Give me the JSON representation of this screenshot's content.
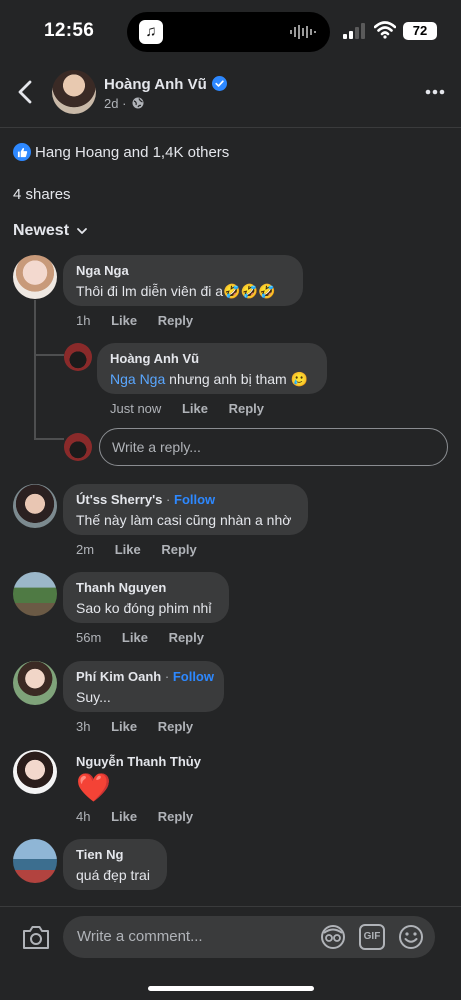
{
  "status_bar": {
    "time": "12:56",
    "battery": "72",
    "music_glyph": "♫"
  },
  "post": {
    "author_name": "Hoàng Anh Vũ",
    "time": "2d",
    "time_separator": "·",
    "reactions_text": "Hang Hoang and 1,4K others",
    "shares_text": "4 shares",
    "sort_label": "Newest"
  },
  "comments": [
    {
      "name": "Nga Nga",
      "text": "Thôi đi lm diễn viên đi a🤣🤣🤣",
      "time": "1h",
      "like": "Like",
      "reply": "Reply"
    },
    {
      "name": "Hoàng Anh Vũ",
      "mention": "Nga Nga",
      "text": " nhưng anh bị tham 🥲",
      "time": "Just now",
      "like": "Like",
      "reply": "Reply"
    },
    {
      "name": "Út'ss Sherry's",
      "follow": "Follow",
      "text": "Thế này làm casi cũng nhàn a nhờ",
      "time": "2m",
      "like": "Like",
      "reply": "Reply"
    },
    {
      "name": "Thanh Nguyen",
      "text": "Sao ko đóng phim nhỉ",
      "time": "56m",
      "like": "Like",
      "reply": "Reply"
    },
    {
      "name": "Phí Kim Oanh",
      "follow": "Follow",
      "text": "Suy...",
      "time": "3h",
      "like": "Like",
      "reply": "Reply"
    },
    {
      "name": "Nguyễn Thanh Thủy",
      "text": "❤️",
      "time": "4h",
      "like": "Like",
      "reply": "Reply"
    },
    {
      "name": "Tien Ng",
      "text": "quá đẹp trai"
    }
  ],
  "reply_placeholder": "Write a reply...",
  "composer": {
    "placeholder": "Write a comment...",
    "gif_label": "GIF"
  },
  "separator": "·",
  "colors": {
    "background": "#242526",
    "bubble": "#3a3b3c",
    "link": "#2d88ff",
    "muted": "#b0b3b8"
  }
}
